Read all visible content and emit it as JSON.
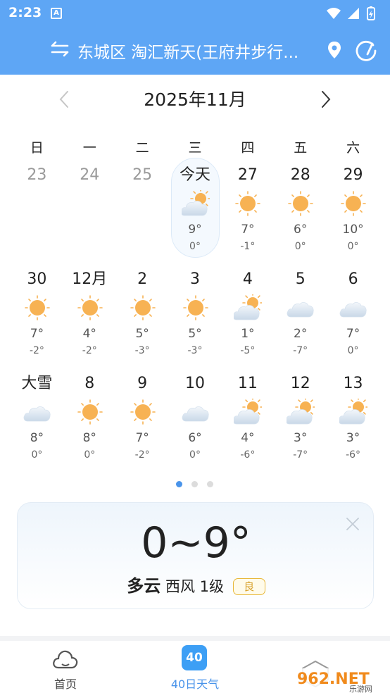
{
  "status": {
    "time": "2:23",
    "notif_glyph": "A"
  },
  "header": {
    "location": "东城区 淘汇新天(王府井步行...",
    "icons": [
      "swap-icon",
      "pin-icon",
      "refresh-icon"
    ]
  },
  "calendar": {
    "month_title": "2025年11月",
    "weekdays": [
      "日",
      "一",
      "二",
      "三",
      "四",
      "五",
      "六"
    ],
    "days": [
      {
        "label": "23",
        "past": true
      },
      {
        "label": "24",
        "past": true
      },
      {
        "label": "25",
        "past": true
      },
      {
        "label": "今天",
        "icon": "partly-cloudy",
        "hi": "9°",
        "lo": "0°",
        "today": true
      },
      {
        "label": "27",
        "icon": "sunny",
        "hi": "7°",
        "lo": "-1°"
      },
      {
        "label": "28",
        "icon": "sunny",
        "hi": "6°",
        "lo": "0°"
      },
      {
        "label": "29",
        "icon": "sunny",
        "hi": "10°",
        "lo": "0°"
      },
      {
        "label": "30",
        "icon": "sunny",
        "hi": "7°",
        "lo": "-2°"
      },
      {
        "label": "12月",
        "icon": "sunny",
        "hi": "4°",
        "lo": "-2°"
      },
      {
        "label": "2",
        "icon": "sunny",
        "hi": "5°",
        "lo": "-3°"
      },
      {
        "label": "3",
        "icon": "sunny",
        "hi": "5°",
        "lo": "-3°"
      },
      {
        "label": "4",
        "icon": "partly-cloudy",
        "hi": "1°",
        "lo": "-5°"
      },
      {
        "label": "5",
        "icon": "cloudy",
        "hi": "2°",
        "lo": "-7°"
      },
      {
        "label": "6",
        "icon": "cloudy",
        "hi": "7°",
        "lo": "0°"
      },
      {
        "label": "大雪",
        "icon": "cloudy",
        "hi": "8°",
        "lo": "0°"
      },
      {
        "label": "8",
        "icon": "sunny",
        "hi": "8°",
        "lo": "0°"
      },
      {
        "label": "9",
        "icon": "sunny",
        "hi": "7°",
        "lo": "-2°"
      },
      {
        "label": "10",
        "icon": "cloudy",
        "hi": "6°",
        "lo": "0°"
      },
      {
        "label": "11",
        "icon": "partly-cloudy",
        "hi": "4°",
        "lo": "-6°"
      },
      {
        "label": "12",
        "icon": "partly-cloudy",
        "hi": "3°",
        "lo": "-7°"
      },
      {
        "label": "13",
        "icon": "partly-cloudy",
        "hi": "3°",
        "lo": "-6°"
      }
    ],
    "page_dots": 3,
    "active_dot": 0
  },
  "summary": {
    "temp_range": "0~9°",
    "condition": "多云",
    "wind": "西风 1级",
    "aqi": "良"
  },
  "bottom_nav": {
    "items": [
      {
        "label": "首页",
        "icon": "cloud-home-icon"
      },
      {
        "label": "40日天气",
        "icon": "calendar-40-icon",
        "badge": "40",
        "active": true
      }
    ]
  },
  "watermark": {
    "text": "962.NET",
    "sub": "乐游网"
  },
  "colors": {
    "header": "#5ea6f5",
    "accent": "#4a94ea",
    "sun": "#f7b253",
    "aqi_good": "#e8b83a"
  }
}
